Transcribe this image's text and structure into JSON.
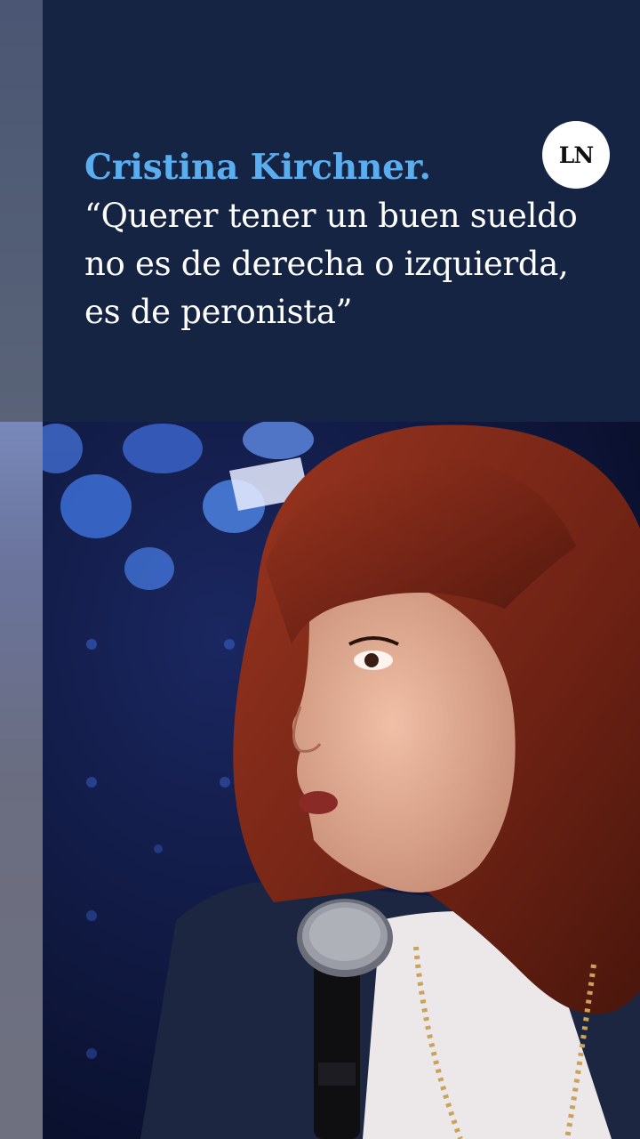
{
  "headline": {
    "name": "Cristina Kirchner.",
    "quote_lines": [
      "“Querer tener un buen sueldo",
      "no es de derecha o izquierda,",
      "es de peronista”"
    ]
  },
  "logo": {
    "text": "LN"
  },
  "colors": {
    "background": "#162444",
    "accent": "#5aaef0",
    "text": "#ffffff"
  }
}
